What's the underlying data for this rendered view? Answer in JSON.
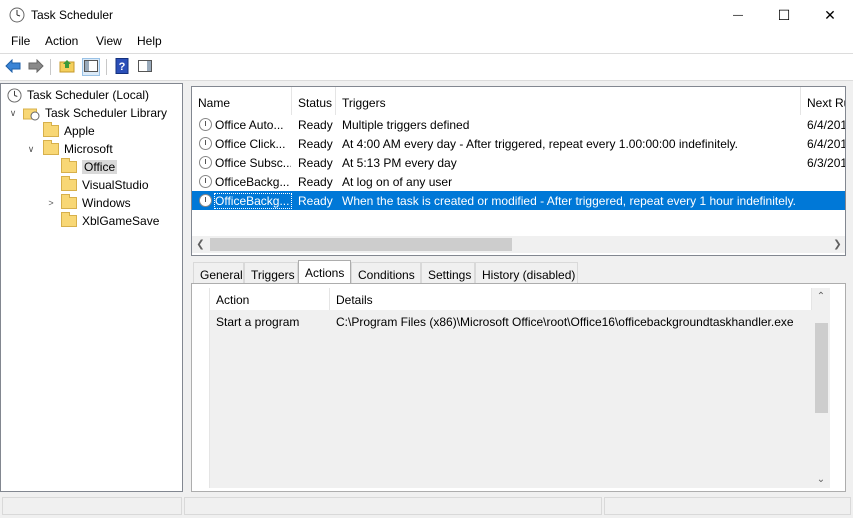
{
  "window": {
    "title": "Task Scheduler",
    "minimize_glyph": "—",
    "maximize_glyph": "☐",
    "close_glyph": "✕"
  },
  "menu": [
    "File",
    "Action",
    "View",
    "Help"
  ],
  "toolbar": {
    "icons": [
      "back-icon",
      "forward-icon",
      "up-folder-icon",
      "show-hide-tree-icon",
      "help-icon",
      "action-pane-icon"
    ]
  },
  "tree": {
    "root": "Task Scheduler (Local)",
    "library": "Task Scheduler Library",
    "apple": "Apple",
    "microsoft": "Microsoft",
    "office": "Office",
    "visualstudio": "VisualStudio",
    "windows": "Windows",
    "xblgamesave": "XblGameSave"
  },
  "tasks": {
    "columns": [
      "Name",
      "Status",
      "Triggers",
      "Next Ru"
    ],
    "rows": [
      {
        "name": "Office Auto...",
        "status": "Ready",
        "trigger": "Multiple triggers defined",
        "next": "6/4/201"
      },
      {
        "name": "Office Click...",
        "status": "Ready",
        "trigger": "At 4:00 AM every day - After triggered, repeat every 1.00:00:00 indefinitely.",
        "next": "6/4/201"
      },
      {
        "name": "Office Subsc...",
        "status": "Ready",
        "trigger": "At 5:13 PM every day",
        "next": "6/3/201"
      },
      {
        "name": "OfficeBackg...",
        "status": "Ready",
        "trigger": "At log on of any user",
        "next": ""
      },
      {
        "name": "OfficeBackg...",
        "status": "Ready",
        "trigger": "When the task is created or modified - After triggered, repeat every 1 hour indefinitely.",
        "next": ""
      }
    ],
    "selected_index": 4
  },
  "tabs": {
    "items": [
      "General",
      "Triggers",
      "Actions",
      "Conditions",
      "Settings",
      "History (disabled)"
    ],
    "active": "Actions"
  },
  "actions_tab": {
    "columns": [
      "Action",
      "Details"
    ],
    "rows": [
      {
        "action": "Start a program",
        "details": "C:\\Program Files (x86)\\Microsoft Office\\root\\Office16\\officebackgroundtaskhandler.exe"
      }
    ]
  },
  "colors": {
    "selection": "#0078d7",
    "tree_selected": "#d9d9d9"
  }
}
